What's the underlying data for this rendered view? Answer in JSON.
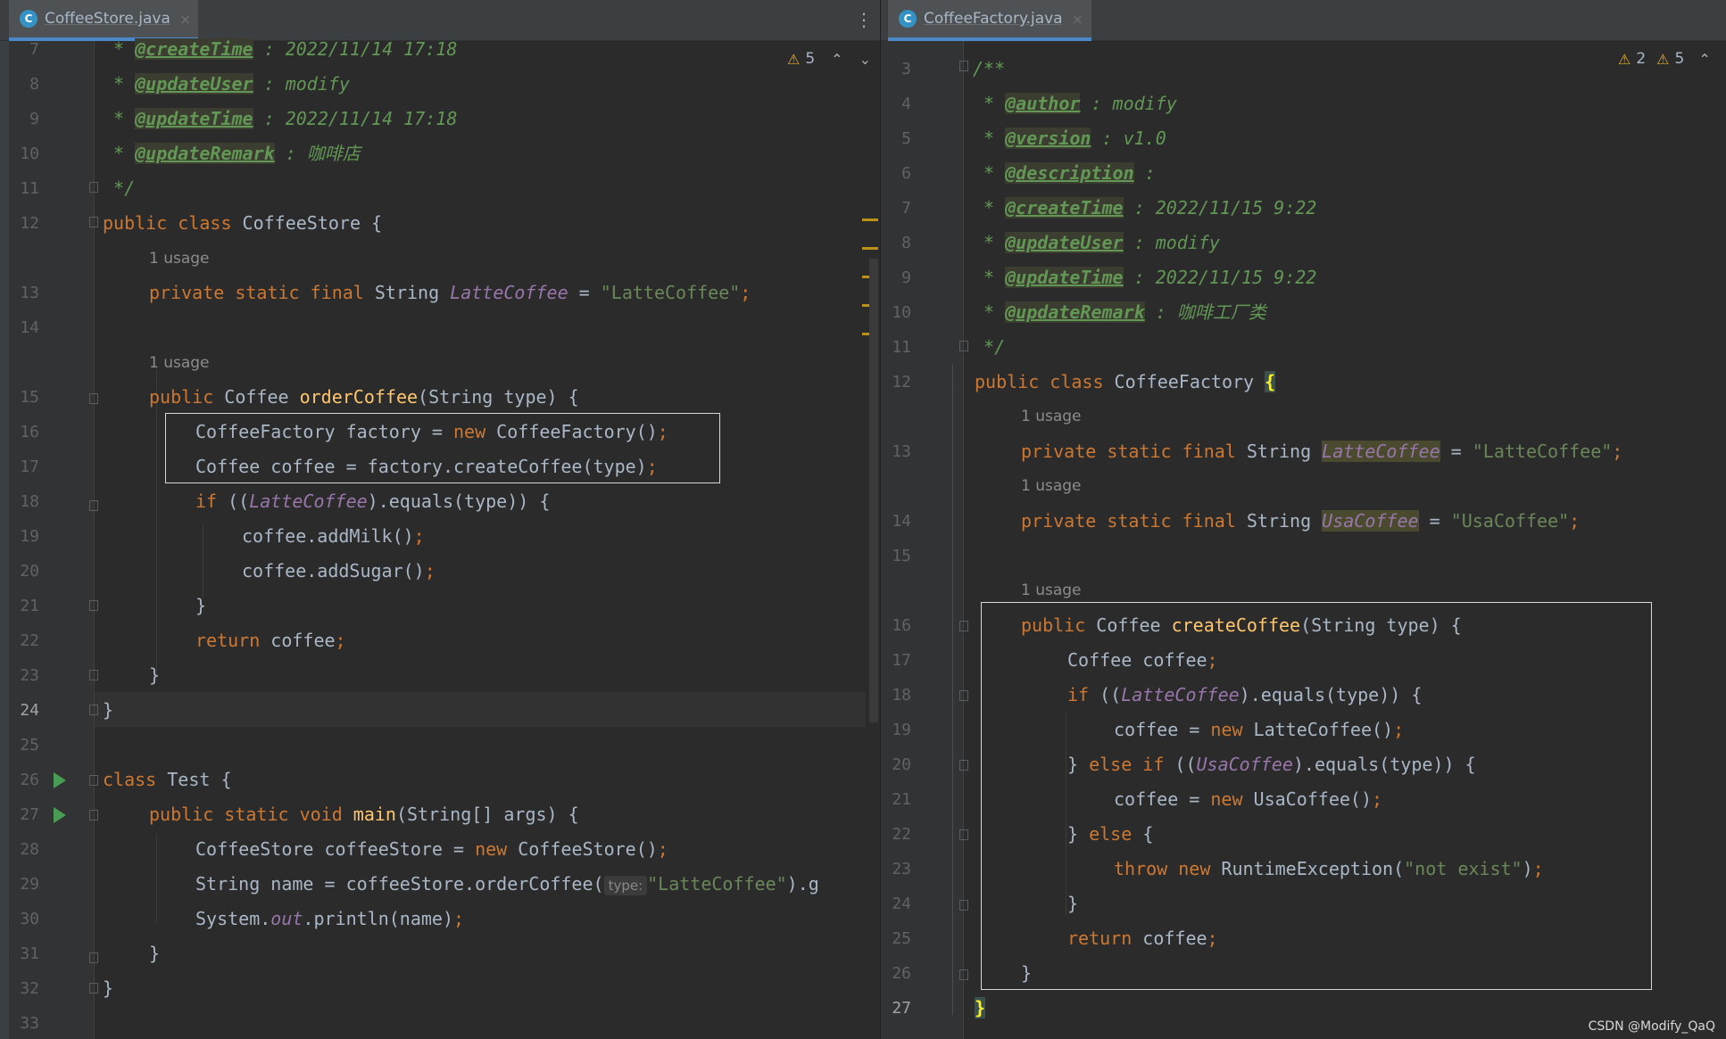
{
  "left_tab": {
    "icon": "C",
    "name": "CoffeeStore.java",
    "close": "×"
  },
  "right_tab": {
    "icon": "C",
    "name": "CoffeeFactory.java",
    "close": "×"
  },
  "left_warnings": {
    "count": "5"
  },
  "right_warnings": {
    "count_a": "2",
    "count_b": "5"
  },
  "left_code": {
    "l7": {
      "n": "7",
      "star": " * ",
      "tag": "@createTime",
      "rest": " : 2022/11/14 17:18"
    },
    "l8": {
      "n": "8",
      "star": " * ",
      "tag": "@updateUser",
      "rest": " : modify"
    },
    "l9": {
      "n": "9",
      "star": " * ",
      "tag": "@updateTime",
      "rest": " : 2022/11/14 17:18"
    },
    "l10": {
      "n": "10",
      "star": " * ",
      "tag": "@updateRemark",
      "rest": " : 咖啡店"
    },
    "l11": {
      "n": "11",
      "text": " */"
    },
    "l12": {
      "n": "12",
      "kw": "public class ",
      "rest": "CoffeeStore {"
    },
    "u13": "1 usage",
    "l13": {
      "n": "13",
      "kw": "private static final ",
      "type": "String ",
      "cn": "LatteCoffee",
      "eq": " = ",
      "st": "\"LatteCoffee\"",
      "semi": ";"
    },
    "l14": {
      "n": "14"
    },
    "u15": "1 usage",
    "l15": {
      "n": "15",
      "kw": "public ",
      "type": "Coffee ",
      "fn": "orderCoffee",
      "rest": "(String type) {"
    },
    "l16": {
      "n": "16",
      "a": "CoffeeFactory factory = ",
      "kw": "new ",
      "b": "CoffeeFactory()",
      "semi": ";"
    },
    "l17": {
      "n": "17",
      "a": "Coffee coffee = factory.createCoffee(type)",
      "semi": ";"
    },
    "l18": {
      "n": "18",
      "kw": "if ",
      "a": "((",
      "cn": "LatteCoffee",
      "b": ").equals(type)) {"
    },
    "l19": {
      "n": "19",
      "a": "coffee.addMilk()",
      "semi": ";"
    },
    "l20": {
      "n": "20",
      "a": "coffee.addSugar()",
      "semi": ";"
    },
    "l21": {
      "n": "21",
      "a": "}"
    },
    "l22": {
      "n": "22",
      "kw": "return ",
      "a": "coffee",
      "semi": ";"
    },
    "l23": {
      "n": "23",
      "a": "}"
    },
    "l24": {
      "n": "24",
      "a": "}"
    },
    "l25": {
      "n": "25"
    },
    "l26": {
      "n": "26",
      "kw": "class ",
      "a": "Test {"
    },
    "l27": {
      "n": "27",
      "kw": "public static void ",
      "fn": "main",
      "a": "(String[] args) {"
    },
    "l28": {
      "n": "28",
      "a": "CoffeeStore coffeeStore = ",
      "kw": "new ",
      "b": "CoffeeStore()",
      "semi": ";"
    },
    "l29": {
      "n": "29",
      "a": "String name = coffeeStore.orderCoffee(",
      "hint": "type:",
      "st": "\"LatteCoffee\"",
      "b": ").g"
    },
    "l30": {
      "n": "30",
      "a": "System.",
      "cn": "out",
      "b": ".println(name)",
      "semi": ";"
    },
    "l31": {
      "n": "31",
      "a": "}"
    },
    "l32": {
      "n": "32",
      "a": "}"
    },
    "l33": {
      "n": "33"
    }
  },
  "right_code": {
    "l3": {
      "n": "3",
      "text": "/**"
    },
    "l4": {
      "n": "4",
      "star": " * ",
      "tag": "@author",
      "rest": " : modify"
    },
    "l5": {
      "n": "5",
      "star": " * ",
      "tag": "@version",
      "rest": " : v1.0"
    },
    "l6": {
      "n": "6",
      "star": " * ",
      "tag": "@description",
      "rest": " :"
    },
    "l7": {
      "n": "7",
      "star": " * ",
      "tag": "@createTime",
      "rest": " : 2022/11/15 9:22"
    },
    "l8": {
      "n": "8",
      "star": " * ",
      "tag": "@updateUser",
      "rest": " : modify"
    },
    "l9": {
      "n": "9",
      "star": " * ",
      "tag": "@updateTime",
      "rest": " : 2022/11/15 9:22"
    },
    "l10": {
      "n": "10",
      "star": " * ",
      "tag": "@updateRemark",
      "rest": " : 咖啡工厂类"
    },
    "l11": {
      "n": "11",
      "text": " */"
    },
    "l12": {
      "n": "12",
      "kw": "public class ",
      "a": "CoffeeFactory ",
      "brace": "{"
    },
    "u13": "1 usage",
    "l13": {
      "n": "13",
      "kw": "private static final ",
      "type": "String ",
      "cn": "LatteCoffee",
      "eq": " = ",
      "st": "\"LatteCoffee\"",
      "semi": ";"
    },
    "u14": "1 usage",
    "l14": {
      "n": "14",
      "kw": "private static final ",
      "type": "String ",
      "cn": "UsaCoffee",
      "eq": " = ",
      "st": "\"UsaCoffee\"",
      "semi": ";"
    },
    "l15": {
      "n": "15"
    },
    "u16": "1 usage",
    "l16": {
      "n": "16",
      "kw": "public ",
      "type": "Coffee ",
      "fn": "createCoffee",
      "a": "(String type) {"
    },
    "l17": {
      "n": "17",
      "a": "Coffee coffee",
      "semi": ";"
    },
    "l18": {
      "n": "18",
      "kw": "if ",
      "a": "((",
      "cn": "LatteCoffee",
      "b": ").equals(type)) {"
    },
    "l19": {
      "n": "19",
      "a": "coffee = ",
      "kw": "new ",
      "b": "LatteCoffee()",
      "semi": ";"
    },
    "l20": {
      "n": "20",
      "a": "} ",
      "kw": "else if ",
      "b": "((",
      "cn": "UsaCoffee",
      "c": ").equals(type)) {"
    },
    "l21": {
      "n": "21",
      "a": "coffee = ",
      "kw": "new ",
      "b": "UsaCoffee()",
      "semi": ";"
    },
    "l22": {
      "n": "22",
      "a": "} ",
      "kw": "else ",
      "b": "{"
    },
    "l23": {
      "n": "23",
      "kw": "throw new ",
      "a": "RuntimeException(",
      "st": "\"not exist\"",
      "b": ")",
      "semi": ";"
    },
    "l24": {
      "n": "24",
      "a": "}"
    },
    "l25": {
      "n": "25",
      "kw": "return ",
      "a": "coffee",
      "semi": ";"
    },
    "l26": {
      "n": "26",
      "a": "}"
    },
    "l27": {
      "n": "27",
      "brace": "}"
    }
  },
  "watermark": "CSDN @Modify_QaQ",
  "colors": {
    "keyword": "#cc7832",
    "function": "#ffc66d",
    "string": "#6a8759",
    "constant": "#9876aa",
    "comment": "#629755",
    "text": "#a9b7c6",
    "background": "#2b2b2b"
  }
}
